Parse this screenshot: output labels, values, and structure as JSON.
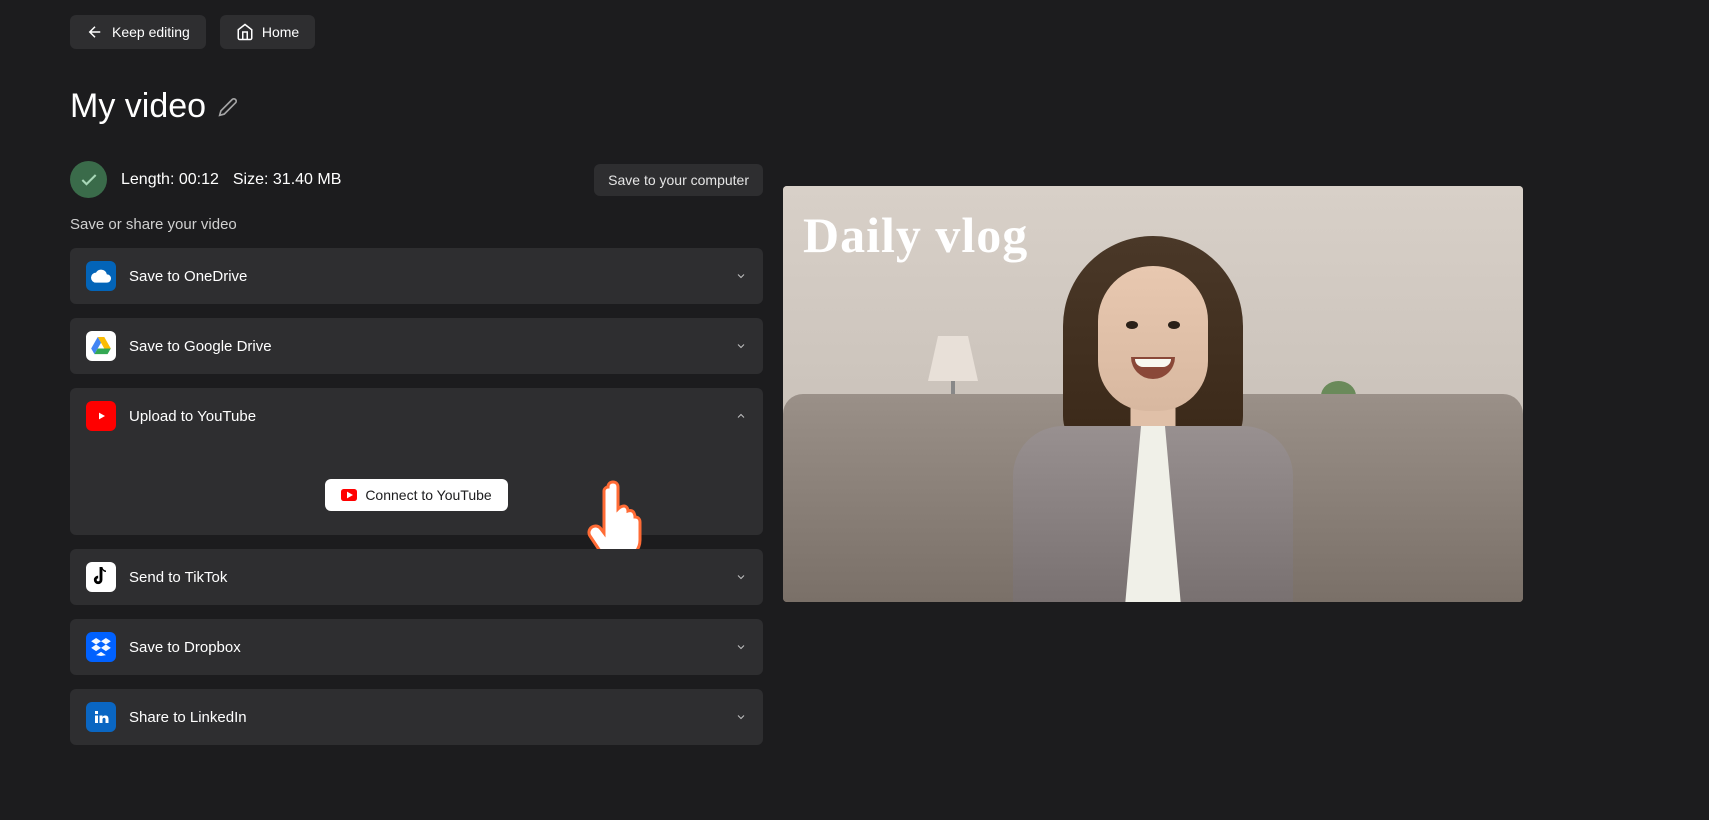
{
  "topNav": {
    "keepEditing": "Keep editing",
    "home": "Home"
  },
  "title": "My video",
  "videoInfo": {
    "length": "Length: 00:12",
    "size": "Size: 31.40 MB"
  },
  "saveToComputer": "Save to your computer",
  "sectionLabel": "Save or share your video",
  "shareTargets": {
    "onedrive": "Save to OneDrive",
    "gdrive": "Save to Google Drive",
    "youtube": "Upload to YouTube",
    "tiktok": "Send to TikTok",
    "dropbox": "Save to Dropbox",
    "linkedin": "Share to LinkedIn"
  },
  "connectYoutube": "Connect to YouTube",
  "previewTitle": "Daily vlog"
}
